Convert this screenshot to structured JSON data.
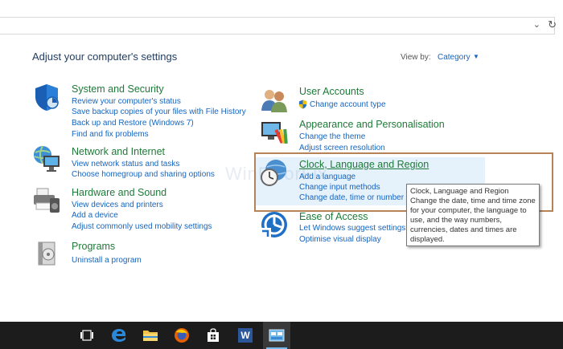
{
  "address": {
    "dropdown_glyph": "⌄",
    "refresh_glyph": "↻"
  },
  "header": {
    "title": "Adjust your computer's settings",
    "view_by_label": "View by:",
    "view_by_value": "Category"
  },
  "categories": {
    "system": {
      "title": "System and Security",
      "links": [
        "Review your computer's status",
        "Save backup copies of your files with File History",
        "Back up and Restore (Windows 7)",
        "Find and fix problems"
      ]
    },
    "network": {
      "title": "Network and Internet",
      "links": [
        "View network status and tasks",
        "Choose homegroup and sharing options"
      ]
    },
    "hardware": {
      "title": "Hardware and Sound",
      "links": [
        "View devices and printers",
        "Add a device",
        "Adjust commonly used mobility settings"
      ]
    },
    "programs": {
      "title": "Programs",
      "links": [
        "Uninstall a program"
      ]
    },
    "users": {
      "title": "User Accounts",
      "links": [
        "Change account type"
      ]
    },
    "appearance": {
      "title": "Appearance and Personalisation",
      "links": [
        "Change the theme",
        "Adjust screen resolution"
      ]
    },
    "clock": {
      "title": "Clock, Language and Region",
      "links": [
        "Add a language",
        "Change input methods",
        "Change date, time or number f"
      ]
    },
    "ease": {
      "title": "Ease of Access",
      "links": [
        "Let Windows suggest settings",
        "Optimise visual display"
      ]
    }
  },
  "tooltip": {
    "title": "Clock, Language and Region",
    "body": "Change the date, time and time zone for your computer, the language to use, and the way numbers, currencies, dates and times are displayed."
  },
  "watermark": "WinErrorFix",
  "taskbar": {
    "word_letter": "W"
  },
  "colors": {
    "link": "#1565c0",
    "title": "#1e7a38",
    "taskbar": "#1c1c1c",
    "highlight_border": "#b58356"
  }
}
